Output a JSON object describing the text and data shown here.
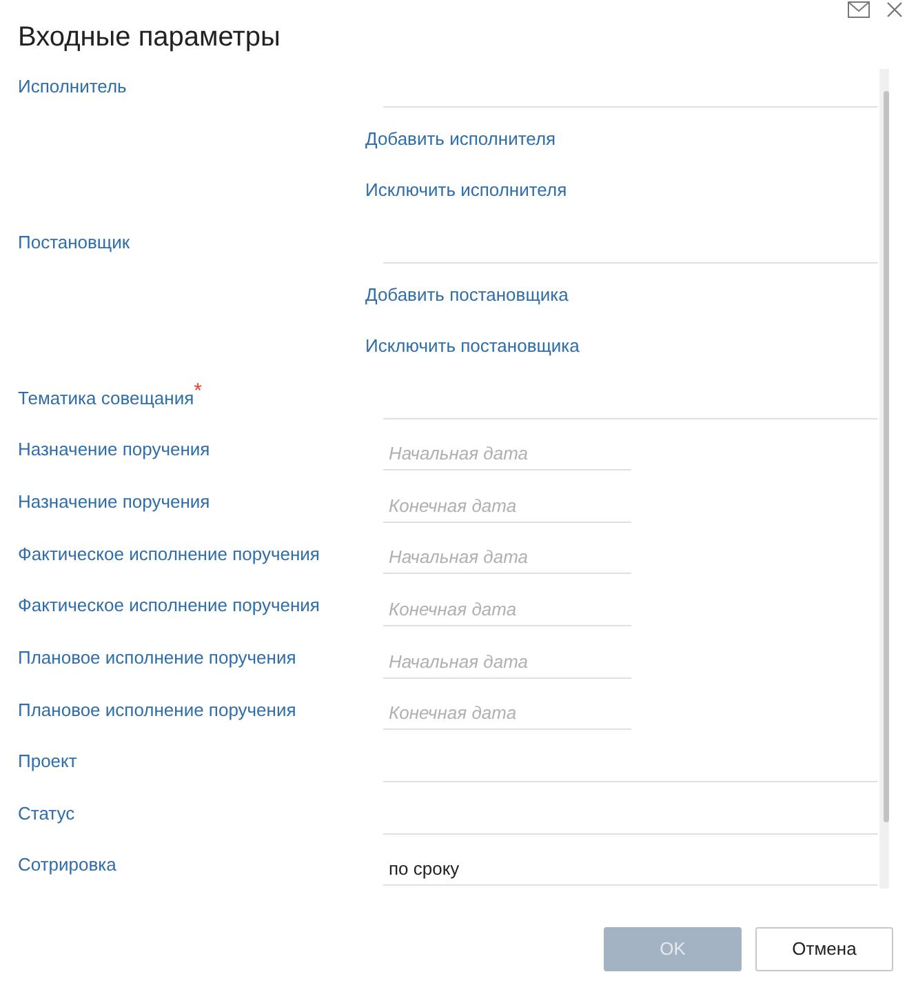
{
  "dialog": {
    "title": "Входные параметры"
  },
  "rows": [
    {
      "kind": "field",
      "label": "Исполнитель"
    },
    {
      "kind": "link",
      "label": "Добавить исполнителя"
    },
    {
      "kind": "link",
      "label": "Исключить исполнителя"
    },
    {
      "kind": "field",
      "label": "Постановщик"
    },
    {
      "kind": "link",
      "label": "Добавить постановщика"
    },
    {
      "kind": "link",
      "label": "Исключить постановщика"
    },
    {
      "kind": "field",
      "label": "Тематика совещания",
      "required_mark": "*"
    },
    {
      "kind": "date",
      "label": "Назначение поручения",
      "placeholder": "Начальная дата"
    },
    {
      "kind": "date",
      "label": "Назначение поручения",
      "placeholder": "Конечная дата"
    },
    {
      "kind": "date",
      "label": "Фактическое исполнение поручения",
      "placeholder": "Начальная дата"
    },
    {
      "kind": "date",
      "label": "Фактическое исполнение поручения",
      "placeholder": "Конечная дата"
    },
    {
      "kind": "date",
      "label": "Плановое исполнение поручения",
      "placeholder": "Начальная дата"
    },
    {
      "kind": "date",
      "label": "Плановое исполнение поручения",
      "placeholder": "Конечная дата"
    },
    {
      "kind": "field",
      "label": "Проект"
    },
    {
      "kind": "field",
      "label": "Статус"
    },
    {
      "kind": "field",
      "label": "Сотрировка",
      "value": "по сроку"
    }
  ],
  "buttons": [
    {
      "kind": "primary",
      "label": "OK",
      "disabled": true
    },
    {
      "kind": "secondary",
      "label": "Отмена",
      "disabled": false
    }
  ]
}
